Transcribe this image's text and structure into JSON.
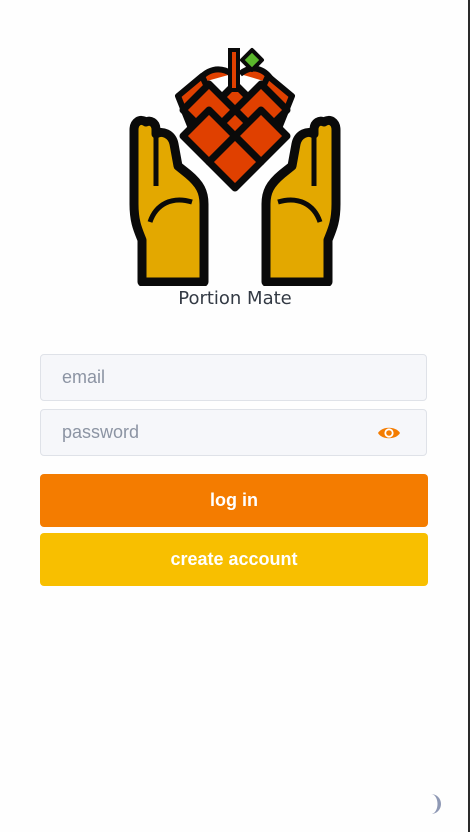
{
  "app": {
    "name": "Portion Mate"
  },
  "login_form": {
    "email_placeholder": "email",
    "password_placeholder": "password",
    "show_password_icon": "eye-icon",
    "login_label": "log in",
    "create_account_label": "create account"
  },
  "theme_toggle": {
    "icon": "moon-icon"
  },
  "colors": {
    "primary": "#f47c00",
    "secondary": "#f8bf00",
    "logo_gold": "#e3a800",
    "logo_red": "#e04000",
    "logo_green": "#5ab72c"
  }
}
